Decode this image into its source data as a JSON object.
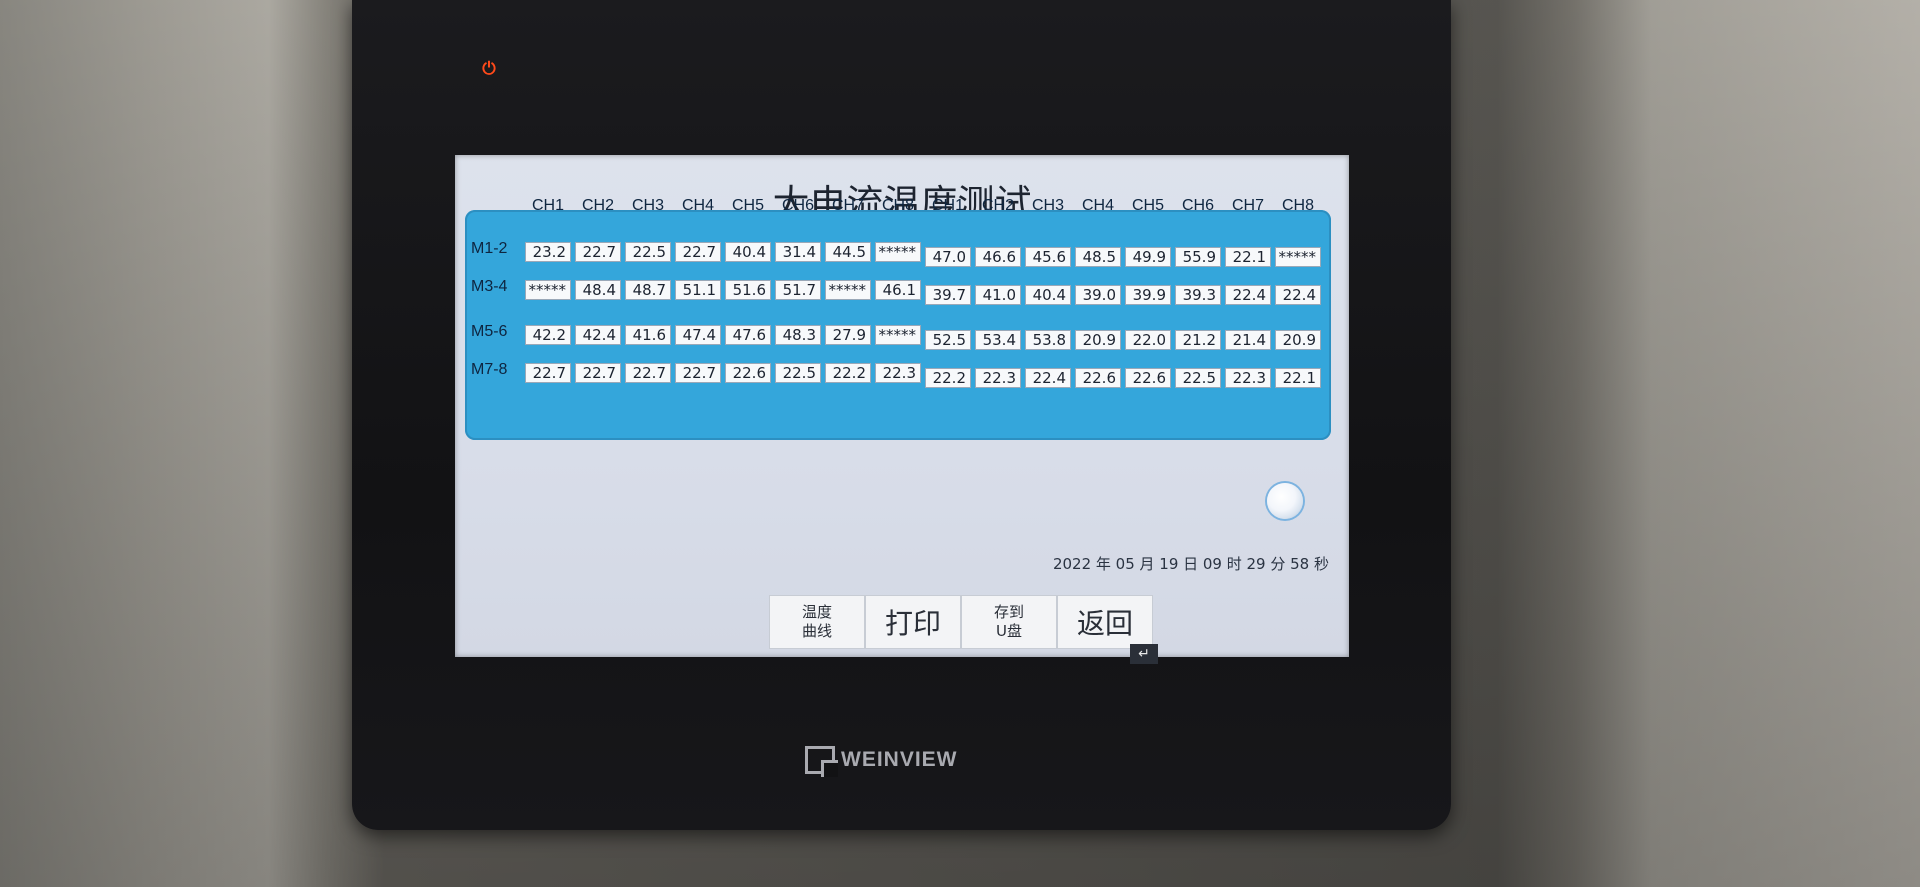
{
  "screen": {
    "title": "大电流温度测试",
    "datetime": "2022 年 05 月 19 日 09 时 29 分 58 秒"
  },
  "channels": {
    "left": [
      "CH1",
      "CH2",
      "CH3",
      "CH4",
      "CH5",
      "CH6",
      "CH7",
      "CH8"
    ],
    "right": [
      "CH1",
      "CH2",
      "CH3",
      "CH4",
      "CH5",
      "CH6",
      "CH7",
      "CH8"
    ]
  },
  "rows": [
    {
      "label": "M1-2",
      "left": [
        "23.2",
        "22.7",
        "22.5",
        "22.7",
        "40.4",
        "31.4",
        "44.5",
        "*****"
      ],
      "right": [
        "47.0",
        "46.6",
        "45.6",
        "48.5",
        "49.9",
        "55.9",
        "22.1",
        "*****"
      ]
    },
    {
      "label": "M3-4",
      "left": [
        "*****",
        "48.4",
        "48.7",
        "51.1",
        "51.6",
        "51.7",
        "*****",
        "46.1"
      ],
      "right": [
        "39.7",
        "41.0",
        "40.4",
        "39.0",
        "39.9",
        "39.3",
        "22.4",
        "22.4"
      ]
    },
    {
      "label": "M5-6",
      "left": [
        "42.2",
        "42.4",
        "41.6",
        "47.4",
        "47.6",
        "48.3",
        "27.9",
        "*****"
      ],
      "right": [
        "52.5",
        "53.4",
        "53.8",
        "20.9",
        "22.0",
        "21.2",
        "21.4",
        "20.9"
      ]
    },
    {
      "label": "M7-8",
      "left": [
        "22.7",
        "22.7",
        "22.7",
        "22.7",
        "22.6",
        "22.5",
        "22.2",
        "22.3"
      ],
      "right": [
        "22.2",
        "22.3",
        "22.4",
        "22.6",
        "22.6",
        "22.5",
        "22.3",
        "22.1"
      ]
    }
  ],
  "buttons": {
    "curve": [
      "温度",
      "曲线"
    ],
    "print": "打印",
    "save": [
      "存到",
      "U盘"
    ],
    "back": "返回"
  },
  "device": {
    "brand": "WEINVIEW"
  },
  "icons": {
    "power": "power-icon",
    "back_corner": "return-arrow-icon",
    "knob": "round-indicator-icon"
  }
}
